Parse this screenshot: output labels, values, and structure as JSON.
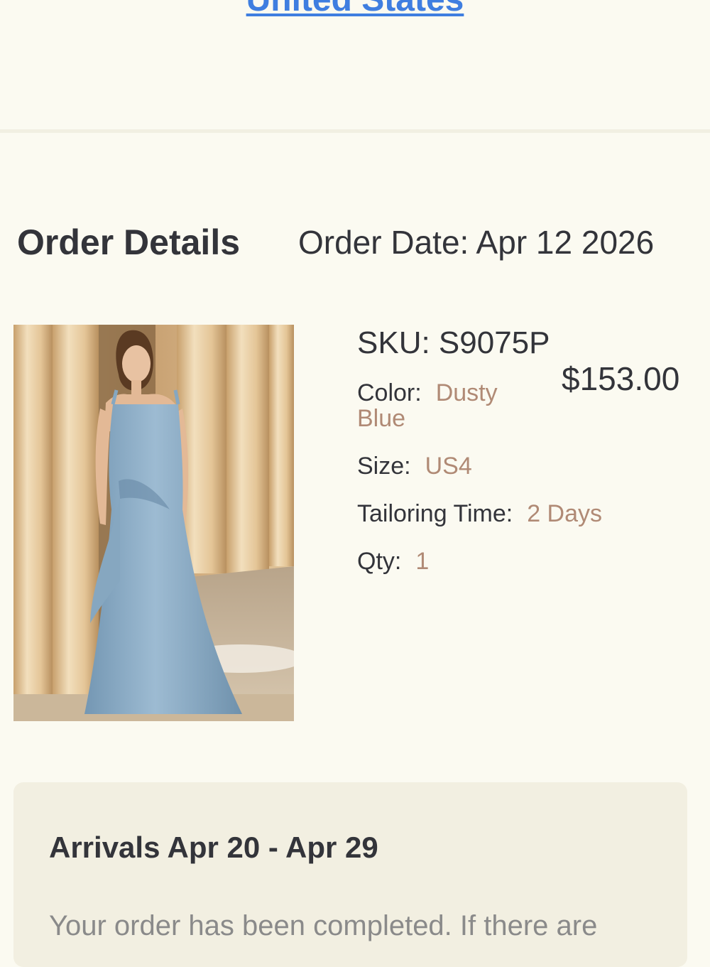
{
  "header": {
    "country_link": "United States"
  },
  "order": {
    "title": "Order Details",
    "date": "Order Date: Apr 12 2026"
  },
  "item": {
    "image_icon": "dress-product-photo",
    "sku": "SKU: S9075P",
    "price": "$153.00",
    "color_label": "Color:",
    "color_value": "Dusty Blue",
    "size_label": "Size:",
    "size_value": "US4",
    "tailoring_label": "Tailoring Time:",
    "tailoring_value": "2 Days",
    "qty_label": "Qty:",
    "qty_value": "1"
  },
  "arrival": {
    "title": "Arrivals Apr 20 - Apr 29",
    "message": "Your order has been completed. If there are"
  },
  "colors": {
    "background": "#fbfaf1",
    "link": "#3f7ee0",
    "text": "#33343a",
    "accent_value": "#b08a75",
    "card_bg": "#f2efe1",
    "muted_text": "#8a8a8a",
    "dress": "#8fb0c9"
  }
}
